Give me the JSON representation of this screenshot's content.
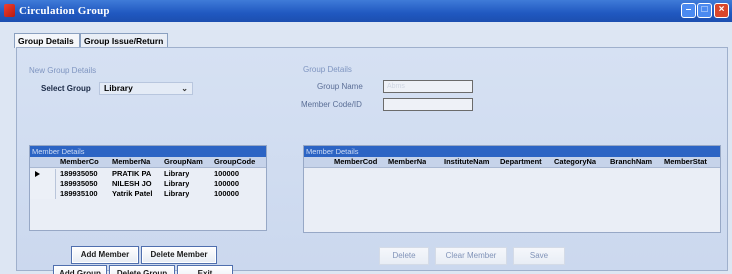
{
  "window": {
    "title": "Circulation Group",
    "controls": {
      "minimize": "–",
      "maximize": "□",
      "close": "×"
    }
  },
  "tabs": [
    {
      "label": "Group Details",
      "active": true
    },
    {
      "label": "Group Issue/Return",
      "active": false
    }
  ],
  "new_group": {
    "section_label": "New Group Details",
    "select_label": "Select Group",
    "select_value": "Library"
  },
  "group_details": {
    "section_label": "Group Details",
    "group_name_label": "Group Name",
    "group_name_value": "Abms",
    "member_code_label": "Member Code/ID",
    "member_code_value": ""
  },
  "member_grid_left": {
    "title": "Member Details",
    "columns": [
      "MemberCo",
      "MemberNa",
      "GroupNam",
      "GroupCode"
    ],
    "rows": [
      [
        "189935050",
        "PRATIK PA",
        "Library",
        "100000"
      ],
      [
        "189935050",
        "NILESH JO",
        "Library",
        "100000"
      ],
      [
        "189935100",
        "Yatrik Patel",
        "Library",
        "100000"
      ]
    ]
  },
  "member_grid_right": {
    "title": "Member Details",
    "columns": [
      "MemberCod",
      "MemberNa",
      "InstituteNam",
      "Department",
      "CategoryNa",
      "BranchNam",
      "MemberStat"
    ]
  },
  "buttons": {
    "add_member": "Add Member",
    "delete_member": "Delete Member",
    "add_group": "Add Group",
    "delete_group": "Delete Group",
    "exit": "Exit",
    "delete": "Delete",
    "clear_member": "Clear Member",
    "save": "Save"
  },
  "colors": {
    "titlebar": "#2058c0",
    "grid_title": "#2c64c4",
    "panel": "#d6e1f3"
  }
}
